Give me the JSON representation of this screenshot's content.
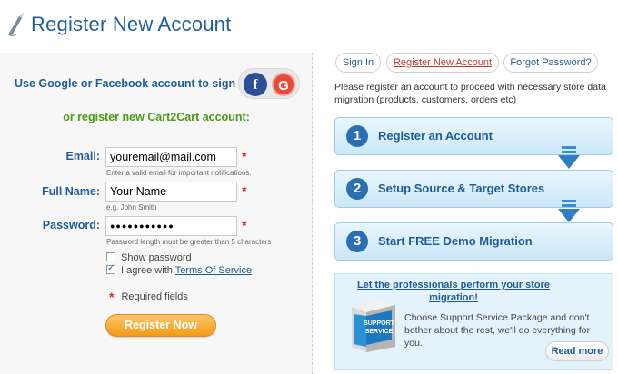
{
  "header": {
    "title": "Register New Account"
  },
  "social": {
    "label": "Use Google or Facebook account to sign in:",
    "facebook_glyph": "f",
    "google_glyph": "G"
  },
  "form": {
    "subtitle": "or register new Cart2Cart account:",
    "email": {
      "label": "Email:",
      "value": "youremail@mail.com",
      "hint": "Enter a valid email for important notifications."
    },
    "full_name": {
      "label": "Full Name:",
      "value": "Your Name",
      "hint": "e.g. John Smith"
    },
    "password": {
      "label": "Password:",
      "value": "●●●●●●●●●●●",
      "hint": "Password length must be greater than 5 characters"
    },
    "required_star": "*",
    "show_password": {
      "label": "Show password",
      "checked": false
    },
    "agree": {
      "label": "I agree with",
      "link": "Terms Of Service",
      "checked": true
    },
    "required_note": "Required fields",
    "register_button": "Register Now"
  },
  "tabs": [
    {
      "label": "Sign In",
      "active": false
    },
    {
      "label": "Register New Account",
      "active": true
    },
    {
      "label": "Forgot Password?",
      "active": false
    }
  ],
  "intro_text": "Please register an account to proceed with necessary store data migration (products, customers, orders etc)",
  "steps": [
    {
      "num": "1",
      "label": "Register an Account"
    },
    {
      "num": "2",
      "label": "Setup Source & Target Stores"
    },
    {
      "num": "3",
      "label": "Start FREE Demo Migration"
    }
  ],
  "promo": {
    "title": "Let the professionals perform your store migration!",
    "box_lines": [
      "SUPPORT",
      "SERVICE"
    ],
    "text": "Choose Support Service Package and don't bother about the rest, we'll do everything for you.",
    "read_more": "Read more"
  },
  "colors": {
    "accent_blue": "#1d5c99",
    "accent_green": "#4c9a16",
    "accent_orange": "#f29a17",
    "required_red": "#d62b2b"
  }
}
